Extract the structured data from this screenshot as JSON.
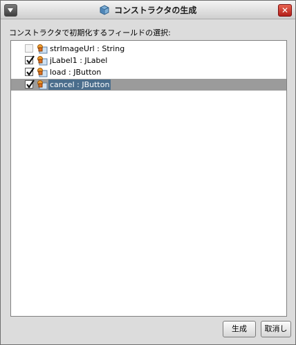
{
  "window": {
    "title": "コンストラクタの生成"
  },
  "prompt": "コンストラクタで初期化するフィールドの選択:",
  "fields": [
    {
      "label": "strImageUrl : String",
      "checked": false,
      "selected": false
    },
    {
      "label": "jLabel1 : JLabel",
      "checked": true,
      "selected": false
    },
    {
      "label": "load : JButton",
      "checked": true,
      "selected": false
    },
    {
      "label": "cancel : JButton",
      "checked": true,
      "selected": true
    }
  ],
  "buttons": {
    "ok_label": "生成",
    "cancel_label": "取消し"
  },
  "colors": {
    "selection_row": "#9b9b9b",
    "selection_label": "#4a6d8c",
    "close_button": "#c9322a"
  }
}
